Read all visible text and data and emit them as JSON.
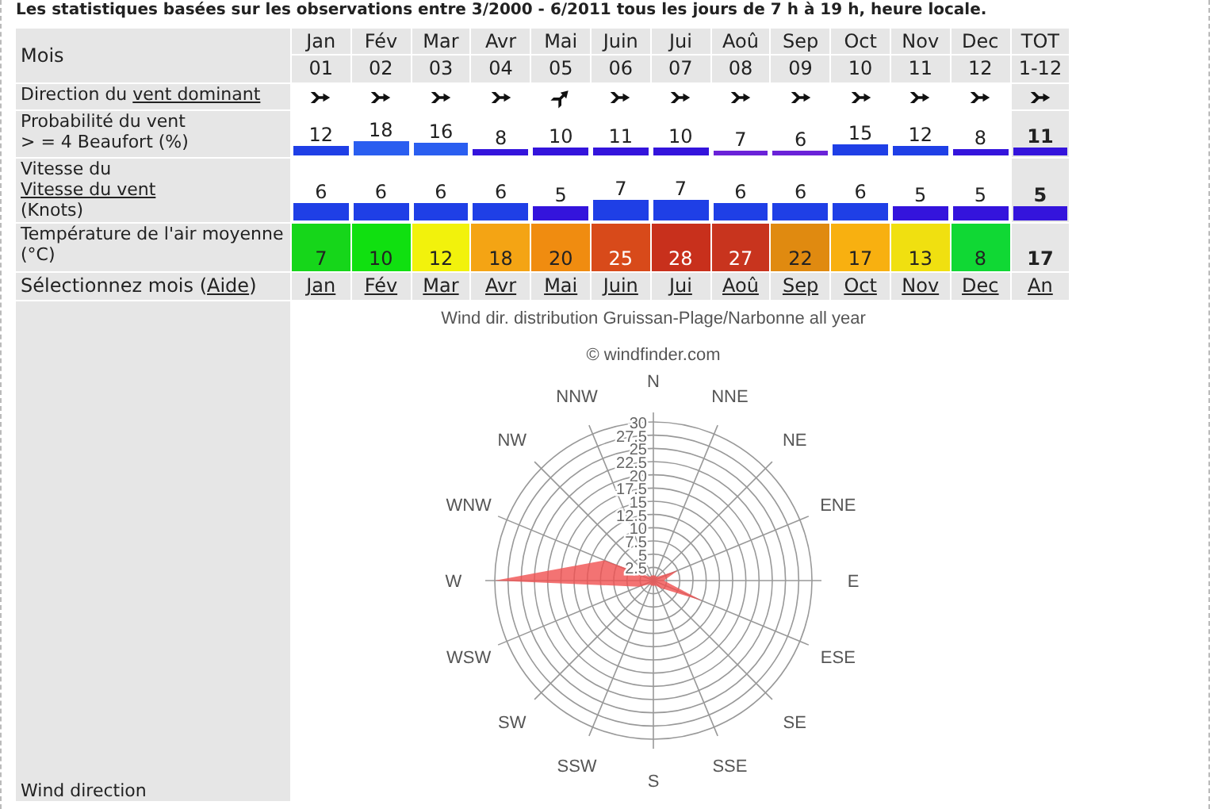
{
  "intro": "Les statistiques basées sur les observations entre 3/2000 - 6/2011 tous les jours de 7 h à 19 h, heure locale.",
  "table": {
    "header_label": "Mois",
    "direction_label": {
      "text": "Direction du",
      "link": "vent dominant"
    },
    "probability_label": [
      "Probabilité du vent",
      "> = 4 Beaufort (%)"
    ],
    "speed_label": {
      "text": "Vitesse du",
      "link": "Vitesse du vent",
      "unit": "(Knots)"
    },
    "temperature_label": "Température de l'air moyenne (°C)",
    "select_label": {
      "before": "Sélectionnez mois (",
      "link": "Aide",
      "after": ")"
    },
    "columns": [
      {
        "kind": "month",
        "name": "Jan",
        "num": "01",
        "arrow_tilted": false,
        "probability": {
          "value": "12",
          "color": "#1f3fe6"
        },
        "speed": {
          "value": "6",
          "color": "#1f3fe6"
        },
        "temperature": {
          "value": "7",
          "color": "#16d61a"
        },
        "link": "Jan"
      },
      {
        "kind": "month",
        "name": "Fév",
        "num": "02",
        "arrow_tilted": false,
        "probability": {
          "value": "18",
          "color": "#2a5ef0"
        },
        "speed": {
          "value": "6",
          "color": "#1f3fe6"
        },
        "temperature": {
          "value": "10",
          "color": "#10e010"
        },
        "link": "Fév"
      },
      {
        "kind": "month",
        "name": "Mar",
        "num": "03",
        "arrow_tilted": false,
        "probability": {
          "value": "16",
          "color": "#2a5ef0"
        },
        "speed": {
          "value": "6",
          "color": "#1f3fe6"
        },
        "temperature": {
          "value": "12",
          "color": "#f2f20c"
        },
        "link": "Mar"
      },
      {
        "kind": "month",
        "name": "Avr",
        "num": "04",
        "arrow_tilted": false,
        "probability": {
          "value": "8",
          "color": "#3414dc"
        },
        "speed": {
          "value": "6",
          "color": "#1f3fe6"
        },
        "temperature": {
          "value": "18",
          "color": "#f4a414"
        },
        "link": "Avr"
      },
      {
        "kind": "month",
        "name": "Mai",
        "num": "05",
        "arrow_tilted": true,
        "probability": {
          "value": "10",
          "color": "#3414dc"
        },
        "speed": {
          "value": "5",
          "color": "#3414dc"
        },
        "temperature": {
          "value": "20",
          "color": "#f08c10"
        },
        "link": "Mai"
      },
      {
        "kind": "month",
        "name": "Juin",
        "num": "06",
        "arrow_tilted": false,
        "probability": {
          "value": "11",
          "color": "#3414dc"
        },
        "speed": {
          "value": "7",
          "color": "#1f3fe6"
        },
        "temperature": {
          "value": "25",
          "color": "#d84a1a"
        },
        "link": "Juin"
      },
      {
        "kind": "month",
        "name": "Jui",
        "num": "07",
        "arrow_tilted": false,
        "probability": {
          "value": "10",
          "color": "#3414dc"
        },
        "speed": {
          "value": "7",
          "color": "#1f3fe6"
        },
        "temperature": {
          "value": "28",
          "color": "#c8301c"
        },
        "link": "Jui"
      },
      {
        "kind": "month",
        "name": "Aoû",
        "num": "08",
        "arrow_tilted": false,
        "probability": {
          "value": "7",
          "color": "#6a22d8"
        },
        "speed": {
          "value": "6",
          "color": "#1f3fe6"
        },
        "temperature": {
          "value": "27",
          "color": "#c8341e"
        },
        "link": "Aoû"
      },
      {
        "kind": "month",
        "name": "Sep",
        "num": "09",
        "arrow_tilted": false,
        "probability": {
          "value": "6",
          "color": "#6a22d8"
        },
        "speed": {
          "value": "6",
          "color": "#1f3fe6"
        },
        "temperature": {
          "value": "22",
          "color": "#e08a10"
        },
        "link": "Sep"
      },
      {
        "kind": "month",
        "name": "Oct",
        "num": "10",
        "arrow_tilted": false,
        "probability": {
          "value": "15",
          "color": "#1f3fe6"
        },
        "speed": {
          "value": "6",
          "color": "#1f3fe6"
        },
        "temperature": {
          "value": "17",
          "color": "#f8b010"
        },
        "link": "Oct"
      },
      {
        "kind": "month",
        "name": "Nov",
        "num": "11",
        "arrow_tilted": false,
        "probability": {
          "value": "12",
          "color": "#1f3fe6"
        },
        "speed": {
          "value": "5",
          "color": "#3414dc"
        },
        "temperature": {
          "value": "13",
          "color": "#f0e010"
        },
        "link": "Nov"
      },
      {
        "kind": "month",
        "name": "Dec",
        "num": "12",
        "arrow_tilted": false,
        "probability": {
          "value": "8",
          "color": "#3414dc"
        },
        "speed": {
          "value": "5",
          "color": "#3414dc"
        },
        "temperature": {
          "value": "8",
          "color": "#10d834"
        },
        "link": "Dec"
      },
      {
        "kind": "total",
        "name": "TOT",
        "num": "1-12",
        "arrow_tilted": false,
        "probability": {
          "value": "11",
          "color": "#3414dc"
        },
        "speed": {
          "value": "5",
          "color": "#3414dc"
        },
        "temperature": {
          "value": "17"
        },
        "link": "An"
      }
    ]
  },
  "chart": {
    "title": "Wind dir. distribution Gruissan-Plage/Narbonne all year",
    "credit": "© windfinder.com",
    "directions": [
      "N",
      "NNW",
      "NNE",
      "NW",
      "NE",
      "WNW",
      "ENE",
      "W",
      "E",
      "WSW",
      "ESE",
      "SW",
      "SE",
      "SSW",
      "SSE",
      "S"
    ],
    "ring_labels": [
      "30",
      "27.5",
      "25",
      "22.5",
      "20",
      "17.5",
      "15",
      "12.5",
      "10",
      "7.5",
      "5",
      "2.5"
    ]
  },
  "footer_label": "Wind direction"
}
